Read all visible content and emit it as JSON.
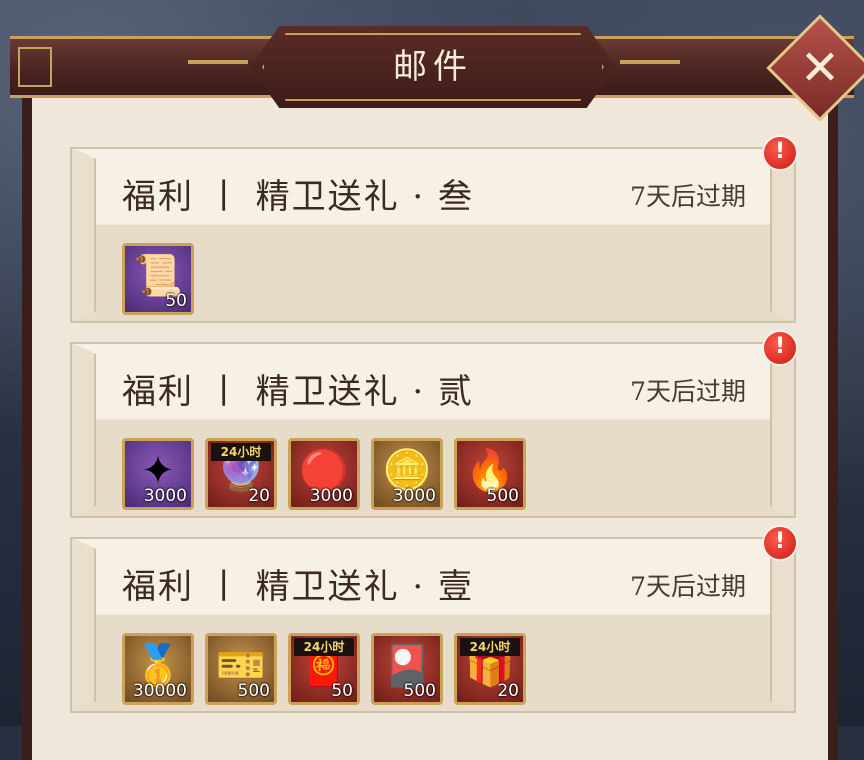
{
  "header": {
    "title": "邮件",
    "close_symbol": "✕"
  },
  "mails": [
    {
      "title": "福利 丨 精卫送礼 · 叁",
      "expire": "7天后过期",
      "alert": "!",
      "items": [
        {
          "icon": "scroll-icon",
          "glyph": "📜",
          "qty": "50",
          "frame": "purple",
          "tag": ""
        }
      ]
    },
    {
      "title": "福利 丨 精卫送礼 · 贰",
      "expire": "7天后过期",
      "alert": "!",
      "items": [
        {
          "icon": "crystal-icon",
          "glyph": "✦",
          "qty": "3000",
          "frame": "purple",
          "tag": ""
        },
        {
          "icon": "gem-orb-icon",
          "glyph": "🔮",
          "qty": "20",
          "frame": "red",
          "tag": "24小时"
        },
        {
          "icon": "red-orb-icon",
          "glyph": "🔴",
          "qty": "3000",
          "frame": "red",
          "tag": ""
        },
        {
          "icon": "gold-coin-icon",
          "glyph": "🪙",
          "qty": "3000",
          "frame": "gold",
          "tag": ""
        },
        {
          "icon": "fire-orb-icon",
          "glyph": "🔥",
          "qty": "500",
          "frame": "red",
          "tag": ""
        }
      ]
    },
    {
      "title": "福利 丨 精卫送礼 · 壹",
      "expire": "7天后过期",
      "alert": "!",
      "items": [
        {
          "icon": "gold-ingot-icon",
          "glyph": "🥇",
          "qty": "30000",
          "frame": "gold",
          "tag": ""
        },
        {
          "icon": "gold-card-icon",
          "glyph": "🎫",
          "qty": "500",
          "frame": "gold",
          "tag": ""
        },
        {
          "icon": "red-envelope-icon",
          "glyph": "🧧",
          "qty": "50",
          "frame": "red",
          "tag": "24小时"
        },
        {
          "icon": "red-card-icon",
          "glyph": "🎴",
          "qty": "500",
          "frame": "red",
          "tag": ""
        },
        {
          "icon": "treasure-chest-icon",
          "glyph": "🎁",
          "qty": "20",
          "frame": "red",
          "tag": "24小时"
        }
      ]
    }
  ]
}
